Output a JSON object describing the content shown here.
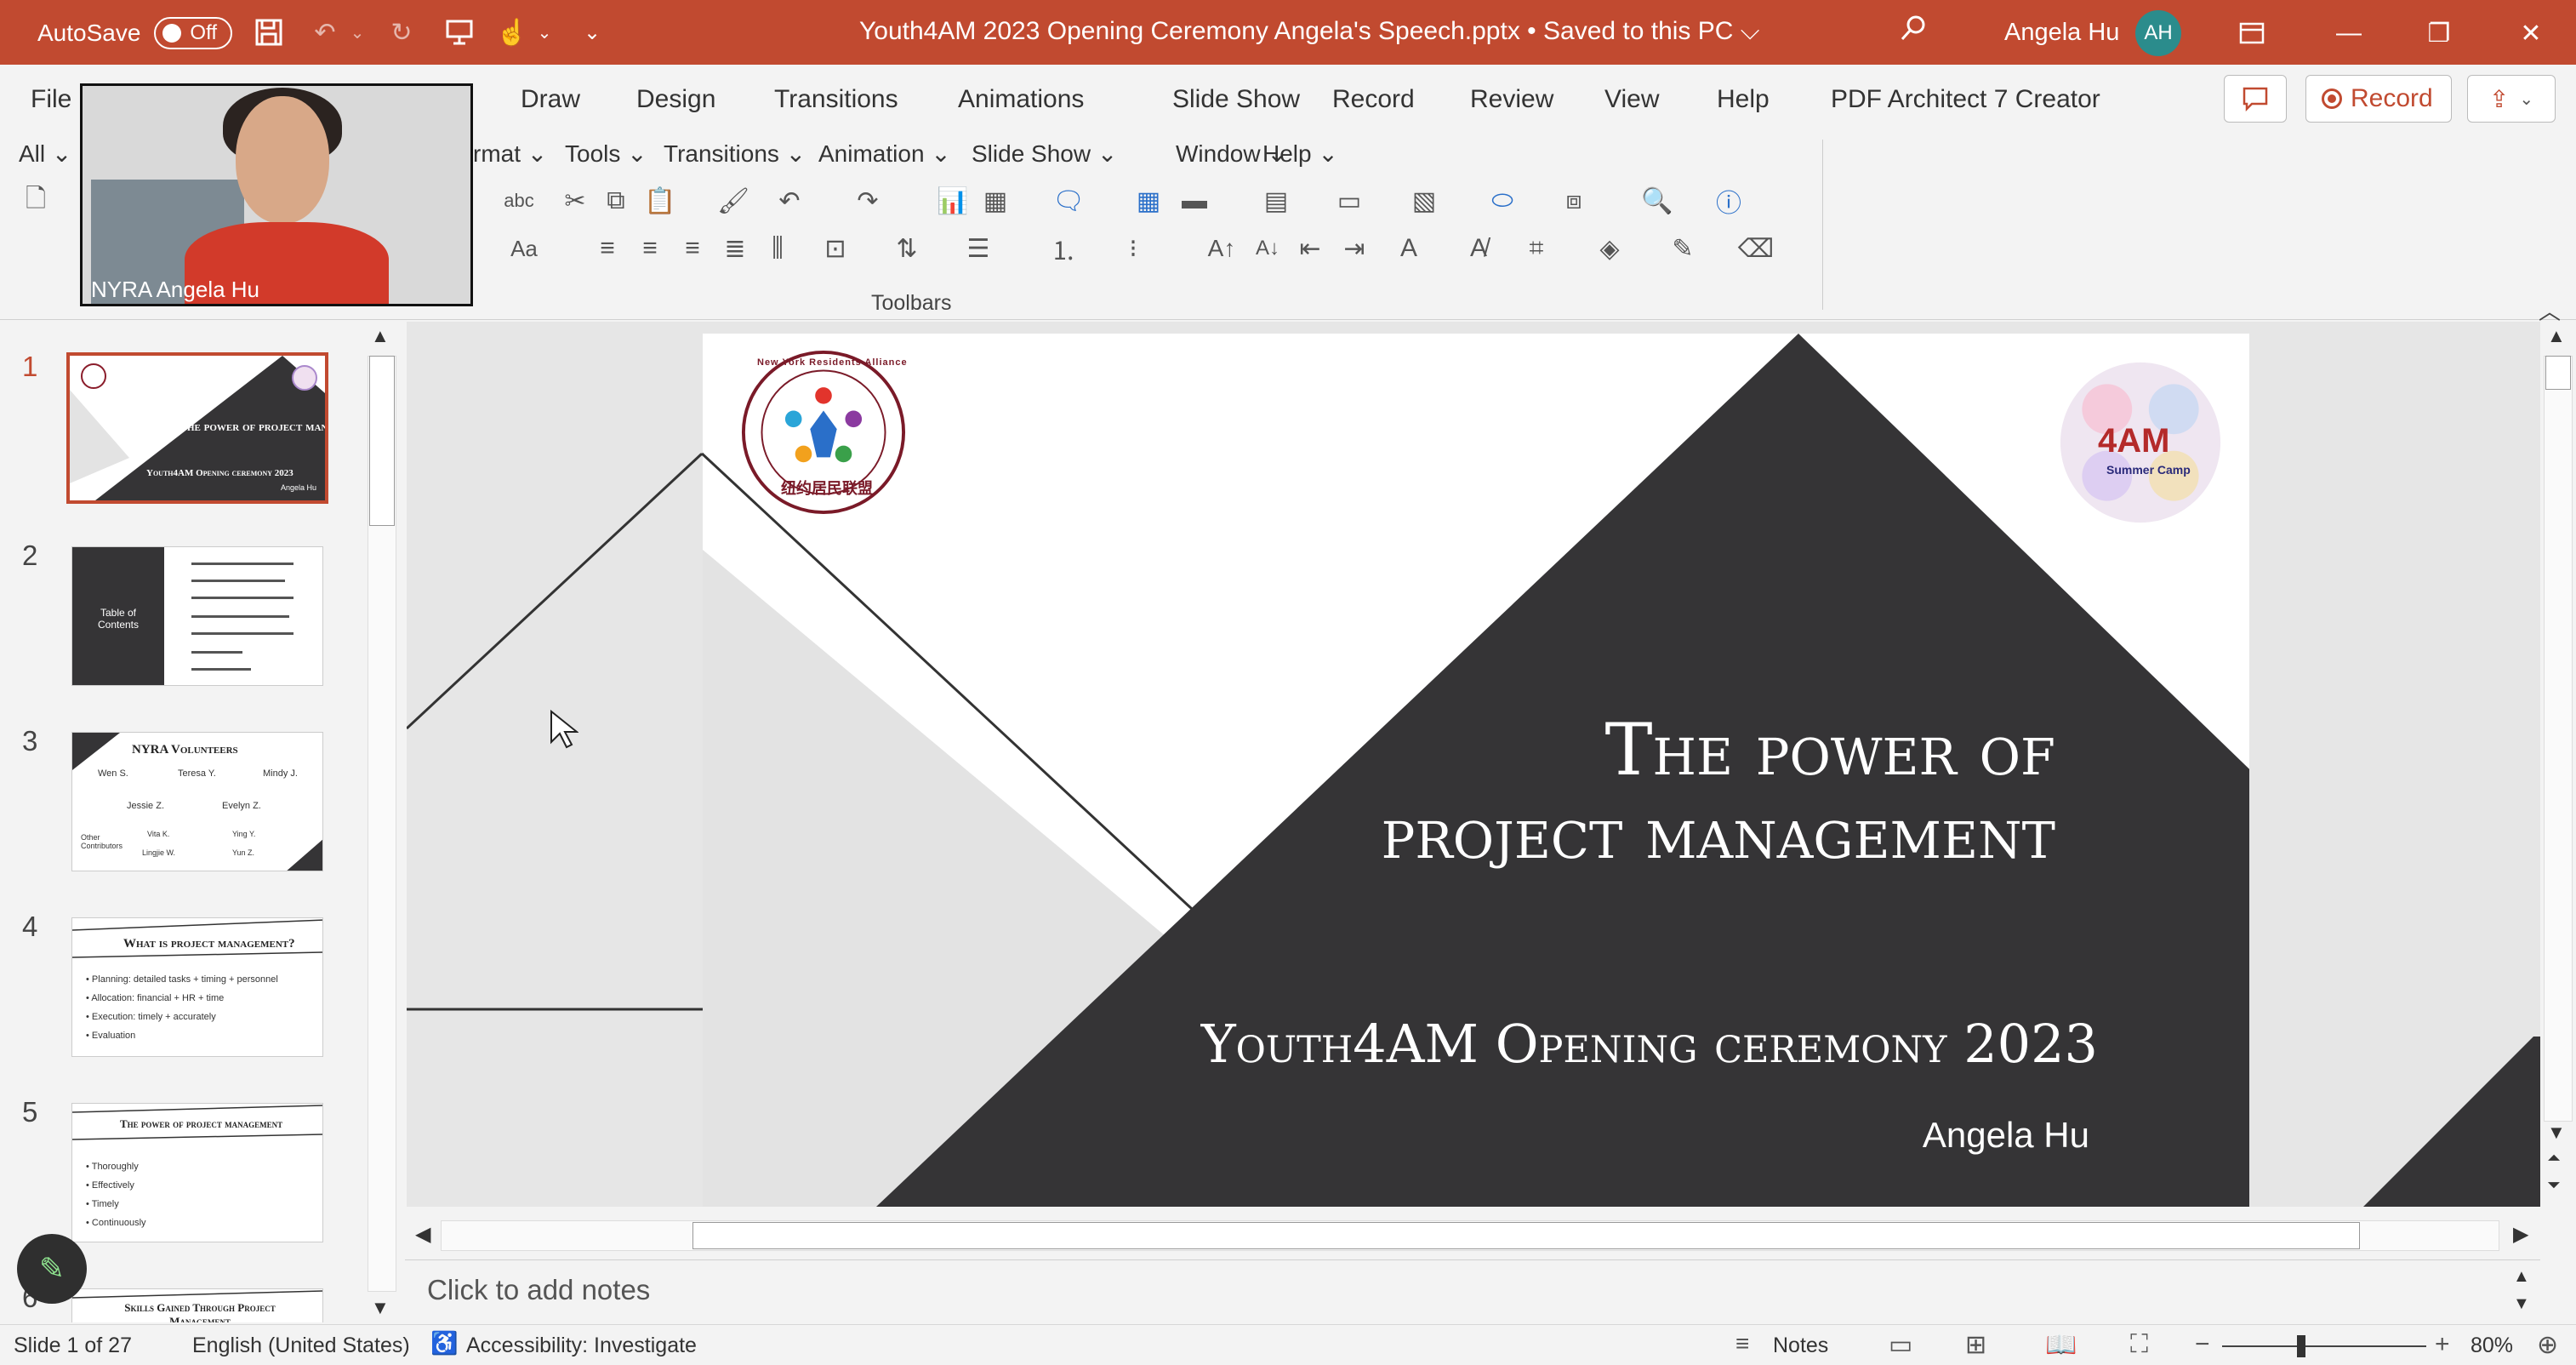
{
  "titlebar": {
    "autosave_label": "AutoSave",
    "autosave_state": "Off",
    "document_title": "Youth4AM 2023 Opening Ceremony Angela's Speech.pptx • Saved to this PC ⌵",
    "user_name": "Angela Hu",
    "user_initials": "AH"
  },
  "menu_tabs": [
    "File",
    "Draw",
    "Design",
    "Transitions",
    "Animations",
    "Slide Show",
    "Record",
    "Review",
    "View",
    "Help",
    "PDF Architect 7 Creator"
  ],
  "record_label": "Record",
  "classic_menus": [
    "All ⌄",
    "rmat ⌄",
    "Tools ⌄",
    "Transitions ⌄",
    "Animation ⌄",
    "Slide Show ⌄",
    "Window ⌄",
    "Help ⌄"
  ],
  "toolbars_label": "Toolbars",
  "webcam_label": "NYRA Angela Hu",
  "thumbnails": [
    {
      "number": "1",
      "title": "The power of project management",
      "subtitle": "Youth4AM Opening ceremony 2023",
      "author": "Angela Hu"
    },
    {
      "number": "2",
      "title": "Table of Contents"
    },
    {
      "number": "3",
      "title": "NYRA Volunteers",
      "names": [
        "Wen S.",
        "Teresa Y.",
        "Mindy J.",
        "Jessie Z.",
        "Evelyn Z."
      ],
      "other_label": "Other Contributors",
      "others": [
        "Vita K.",
        "Ying Y.",
        "Lingjie W.",
        "Yun Z."
      ]
    },
    {
      "number": "4",
      "title": "What is project management?",
      "bullets": [
        "Planning: detailed tasks + timing + personnel",
        "Allocation: financial + HR + time",
        "Execution: timely + accurately",
        "Evaluation"
      ]
    },
    {
      "number": "5",
      "title": "The power of project management",
      "bullets": [
        "Thoroughly",
        "Effectively",
        "Timely",
        "Continuously"
      ]
    },
    {
      "number": "6",
      "title": "Skills Gained Through Project Management"
    }
  ],
  "slide": {
    "title_line1": "The power of",
    "title_line2": "project management",
    "subtitle": "Youth4AM Opening ceremony 2023",
    "author": "Angela Hu",
    "logo_left_text": "New York Residents Alliance",
    "logo_left_cn": "纽约居民联盟",
    "logo_right_text": "4AM",
    "logo_right_sub": "Summer Camp"
  },
  "notes_placeholder": "Click to add notes",
  "status": {
    "slide_counter": "Slide 1 of 27",
    "language": "English (United States)",
    "accessibility": "Accessibility: Investigate",
    "notes_label": "Notes",
    "zoom_level": "80%"
  },
  "colors": {
    "accent": "#c14a30",
    "dark_triangle": "#353436",
    "light_grey": "#e3e3e3"
  }
}
